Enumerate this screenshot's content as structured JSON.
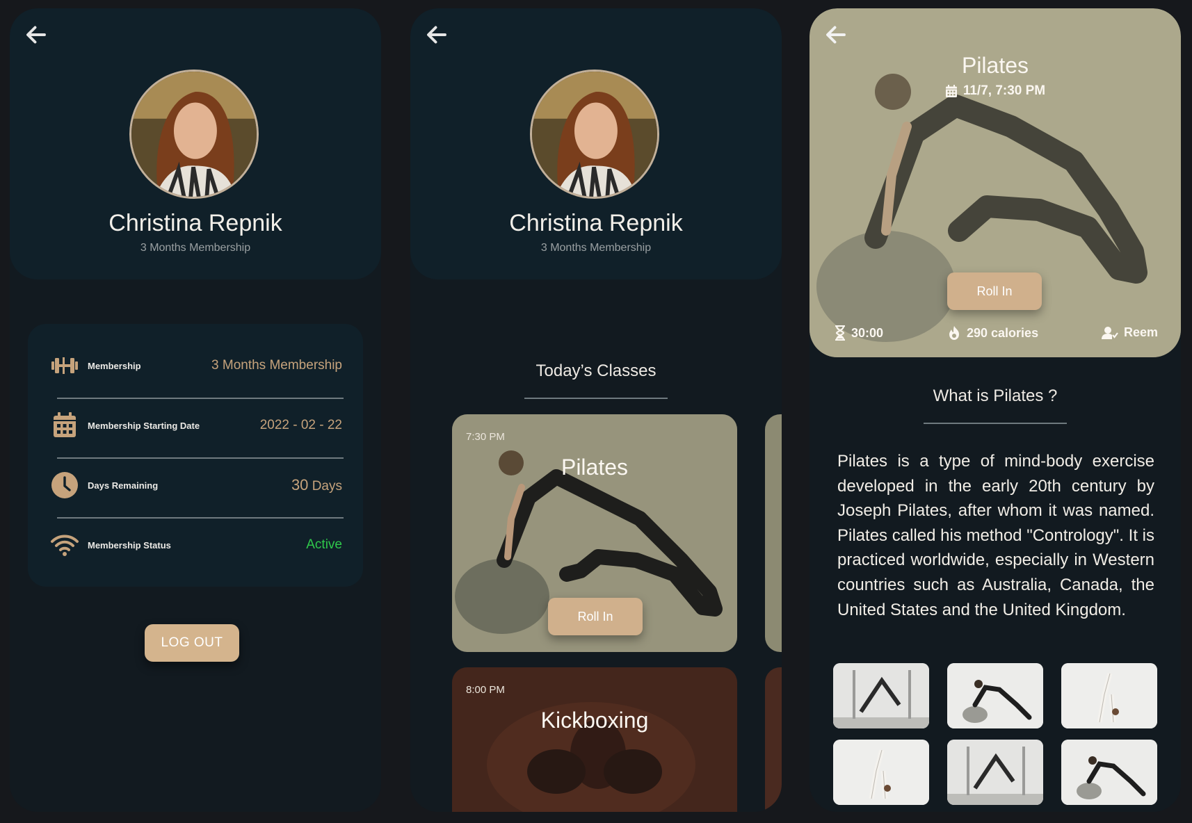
{
  "profile": {
    "name": "Christina Repnik",
    "subtitle": "3 Months Membership"
  },
  "membership_details": [
    {
      "icon": "dumbbell-icon",
      "label": "Membership",
      "value": "3 Months Membership"
    },
    {
      "icon": "calendar-icon",
      "label": "Membership Starting Date",
      "value": "2022 - 02 - 22"
    },
    {
      "icon": "clock-icon",
      "label": "Days Remaining",
      "value_number": "30",
      "value_unit": "Days"
    },
    {
      "icon": "wifi-icon",
      "label": "Membership Status",
      "value": "Active"
    }
  ],
  "logout_label": "LOG OUT",
  "todays_classes": {
    "title": "Today’s Classes",
    "classes": [
      {
        "time": "7:30 PM",
        "name": "Pilates",
        "button": "Roll In"
      },
      {
        "time": "8:00 PM",
        "name": "Kickboxing"
      }
    ]
  },
  "class_detail": {
    "title": "Pilates",
    "date": "11/7,  7:30 PM",
    "button": "Roll In",
    "duration": "30:00",
    "calories": "290 calories",
    "trainer": "Reem",
    "about_title": "What is Pilates ?",
    "about_text": "Pilates is a type of mind-body exercise developed in the early 20th century by Joseph Pilates, after whom it was named. Pilates called his method \"Contrology\". It is practiced worldwide, especially in Western countries such as Australia, Canada, the United States and the United Kingdom."
  },
  "colors": {
    "background": "#16181c",
    "screen": "#121a20",
    "card": "#102029",
    "accent": "#d4b48d",
    "gold_text": "#c6a37c",
    "active_green": "#2fc84b"
  }
}
